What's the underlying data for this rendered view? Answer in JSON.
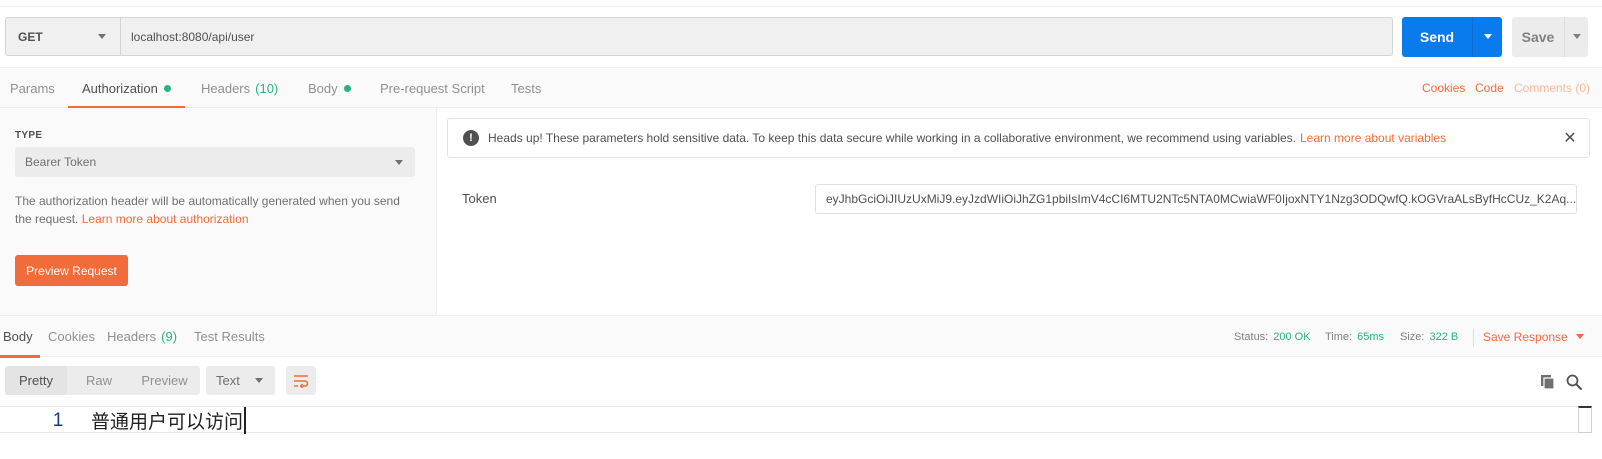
{
  "request": {
    "method": "GET",
    "url": "localhost:8080/api/user",
    "send_label": "Send",
    "save_label": "Save"
  },
  "request_tabs": {
    "params": "Params",
    "authorization": "Authorization",
    "headers": "Headers",
    "headers_count": "(10)",
    "body": "Body",
    "prerequest": "Pre-request Script",
    "tests": "Tests",
    "cookies": "Cookies",
    "code": "Code",
    "comments": "Comments (0)"
  },
  "auth": {
    "type_label": "TYPE",
    "type_value": "Bearer Token",
    "description": "The authorization header will be automatically generated when you send the request.",
    "learn_more": "Learn more about authorization",
    "preview_button": "Preview Request",
    "banner_text": "Heads up! These parameters hold sensitive data. To keep this data secure while working in a collaborative environment, we recommend using variables.",
    "banner_link": "Learn more about variables",
    "token_label": "Token",
    "token_value": "eyJhbGciOiJIUzUxMiJ9.eyJzdWIiOiJhZG1pbiIsImV4cCI6MTU2NTc5NTA0MCwiaWF0IjoxNTY1Nzg3ODQwfQ.kOGVraALsByfHcCUz_K2Aq..."
  },
  "response": {
    "tabs": {
      "body": "Body",
      "cookies": "Cookies",
      "headers": "Headers",
      "headers_count": "(9)",
      "test_results": "Test Results"
    },
    "status_label": "Status:",
    "status_value": "200 OK",
    "time_label": "Time:",
    "time_value": "65ms",
    "size_label": "Size:",
    "size_value": "322 B",
    "save_response": "Save Response",
    "view_modes": [
      "Pretty",
      "Raw",
      "Preview"
    ],
    "format": "Text",
    "line_number": "1",
    "body_text": "普通用户可以访问"
  },
  "colors": {
    "accent": "#f26b3a",
    "primary": "#097bed",
    "success": "#26b47f"
  },
  "icons": {
    "warning": "exclamation-circle-icon",
    "close": "close-icon",
    "wrap": "wrap-lines-icon",
    "copy": "copy-icon",
    "search": "search-icon"
  }
}
